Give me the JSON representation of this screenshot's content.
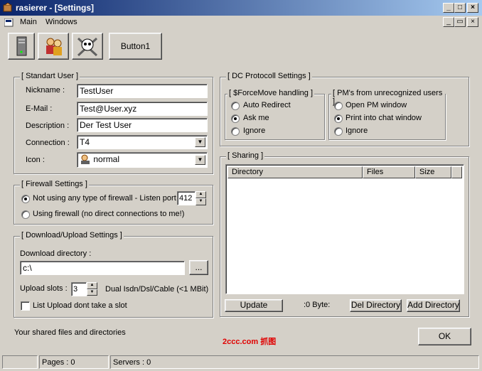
{
  "window": {
    "title": "rasierer - [Settings]"
  },
  "menu": {
    "main": "Main",
    "windows": "Windows"
  },
  "toolbar": {
    "button1_label": "Button1",
    "icons": [
      "server-icon",
      "users-icon",
      "skull-icon"
    ]
  },
  "standart_user": {
    "legend": "[ Standart User ]",
    "nickname_label": "Nickname :",
    "nickname": "TestUser",
    "email_label": "E-Mail :",
    "email": "Test@User.xyz",
    "description_label": "Description :",
    "description": "Der Test User",
    "connection_label": "Connection :",
    "connection": "T4",
    "icon_label": "Icon :",
    "icon": "normal"
  },
  "firewall": {
    "legend": "[ Firewall Settings ]",
    "option1": "Not using any type of firewall - Listen port :",
    "port": "412",
    "option2": "Using firewall (no direct connections to me!)"
  },
  "download": {
    "legend": "[ Download/Upload Settings ]",
    "dir_label": "Download directory :",
    "dir": "c:\\",
    "browse": "...",
    "slots_label": "Upload slots :",
    "slots": "3",
    "connection_type": "Dual Isdn/Dsl/Cable (<1 MBit)",
    "list_upload": "List Upload dont take a slot"
  },
  "dc_protocol": {
    "legend": "[ DC Protocoll Settings ]",
    "forcemove_legend": "[ $ForceMove handling ]",
    "forcemove_options": [
      "Auto Redirect",
      "Ask me",
      "Ignore"
    ],
    "pm_legend": "[ PM's from unrecognized users ]",
    "pm_options": [
      "Open PM window",
      "Print into chat window",
      "Ignore"
    ]
  },
  "sharing": {
    "legend": "[ Sharing ]",
    "columns": [
      "Directory",
      "Files",
      "Size"
    ],
    "update": "Update",
    "byte_label": ":0 Byte:",
    "del_dir": "Del Directory",
    "add_dir": "Add Directory"
  },
  "footer": {
    "hint": "Your shared files and directories",
    "ok": "OK",
    "watermark": "2ccc.com 抓图"
  },
  "status": {
    "pages": "Pages : 0",
    "servers": "Servers : 0"
  }
}
